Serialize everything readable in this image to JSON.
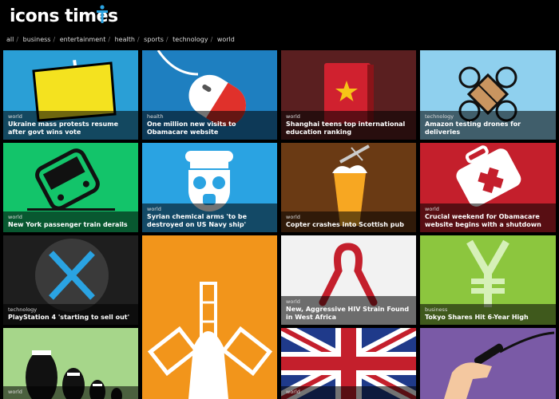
{
  "site": {
    "title": "icons times"
  },
  "nav": [
    "all",
    "business",
    "entertainment",
    "health",
    "sports",
    "technology",
    "world"
  ],
  "tiles": [
    {
      "category": "world",
      "title": "Ukraine mass protests resume after govt wins vote",
      "color": "#2a9fd6",
      "icon": "sign-board-icon"
    },
    {
      "category": "health",
      "title": "One million new visits to Obamacare website",
      "color": "#1e7fc0",
      "icon": "computer-mouse-icon"
    },
    {
      "category": "world",
      "title": "Shanghai teens top international education ranking",
      "color": "#5a1f20",
      "icon": "red-book-icon"
    },
    {
      "category": "technology",
      "title": "Amazon testing drones for deliveries",
      "color": "#8fd0ee",
      "icon": "drone-icon"
    },
    {
      "category": "world",
      "title": "New York passenger train derails",
      "color": "#13c46a",
      "icon": "derailed-train-icon"
    },
    {
      "category": "world",
      "title": "Syrian chemical arms 'to be destroyed on US Navy ship'",
      "color": "#2aa3e2",
      "icon": "sailor-gas-mask-icon"
    },
    {
      "category": "world",
      "title": "Copter crashes into Scottish pub",
      "color": "#6a3a14",
      "icon": "helicopter-beer-icon"
    },
    {
      "category": "world",
      "title": "Crucial weekend for Obamacare website begins with a shutdown",
      "color": "#c41f2c",
      "icon": "first-aid-kit-icon"
    },
    {
      "category": "technology",
      "title": "PlayStation 4 'starting to sell out'",
      "color": "#1e1e1e",
      "icon": "cross-button-icon"
    },
    {
      "category": "",
      "title": "",
      "color": "#f2951b",
      "icon": "windmill-icon"
    },
    {
      "category": "world",
      "title": "New, Aggressive HIV Strain Found in West Africa",
      "color": "#f2f2f2",
      "icon": "red-ribbon-icon"
    },
    {
      "category": "business",
      "title": "Tokyo Shares Hit 6-Year High",
      "color": "#8cc63e",
      "icon": "yen-icon"
    },
    {
      "category": "world",
      "title": "",
      "color": "#a6d68a",
      "icon": "nesting-dolls-icon"
    },
    {
      "category": "world",
      "title": "",
      "color": "#1f3a8a",
      "icon": "union-jack-icon"
    },
    {
      "category": "",
      "title": "",
      "color": "#7a5aa6",
      "icon": "whip-hand-icon"
    }
  ]
}
